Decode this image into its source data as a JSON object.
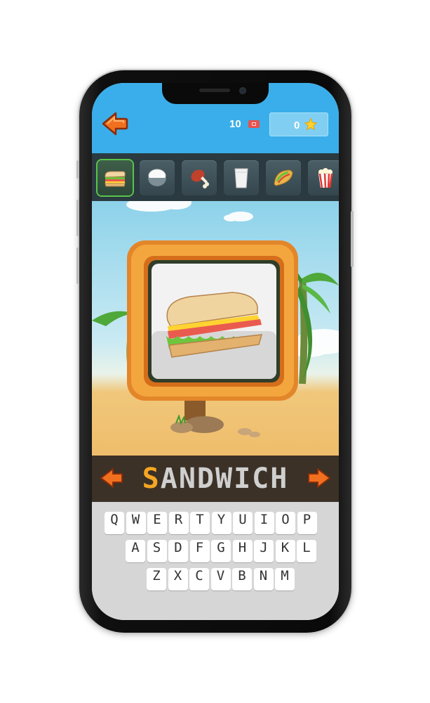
{
  "header": {
    "tickets_count": "10",
    "stars_count": "0",
    "back_icon": "back-arrow-icon",
    "ticket_icon": "ticket-icon",
    "star_icon": "star-icon"
  },
  "categories": [
    {
      "icon": "sandwich-icon",
      "active": true
    },
    {
      "icon": "rice-bowl-icon",
      "active": false
    },
    {
      "icon": "meat-drumstick-icon",
      "active": false
    },
    {
      "icon": "milk-glass-icon",
      "active": false
    },
    {
      "icon": "taco-icon",
      "active": false
    },
    {
      "icon": "popcorn-icon",
      "active": false
    }
  ],
  "word": {
    "highlighted": "S",
    "rest": "ANDWICH"
  },
  "keyboard": {
    "row1": [
      "Q",
      "W",
      "E",
      "R",
      "T",
      "Y",
      "U",
      "I",
      "O",
      "P"
    ],
    "row2": [
      "A",
      "S",
      "D",
      "F",
      "G",
      "H",
      "J",
      "K",
      "L"
    ],
    "row3": [
      "Z",
      "X",
      "C",
      "V",
      "B",
      "N",
      "M"
    ]
  },
  "colors": {
    "sky": "#3aaeea",
    "accent_orange": "#f5a623",
    "active_border": "#59c44b",
    "wordbar_bg": "#3b3126"
  }
}
